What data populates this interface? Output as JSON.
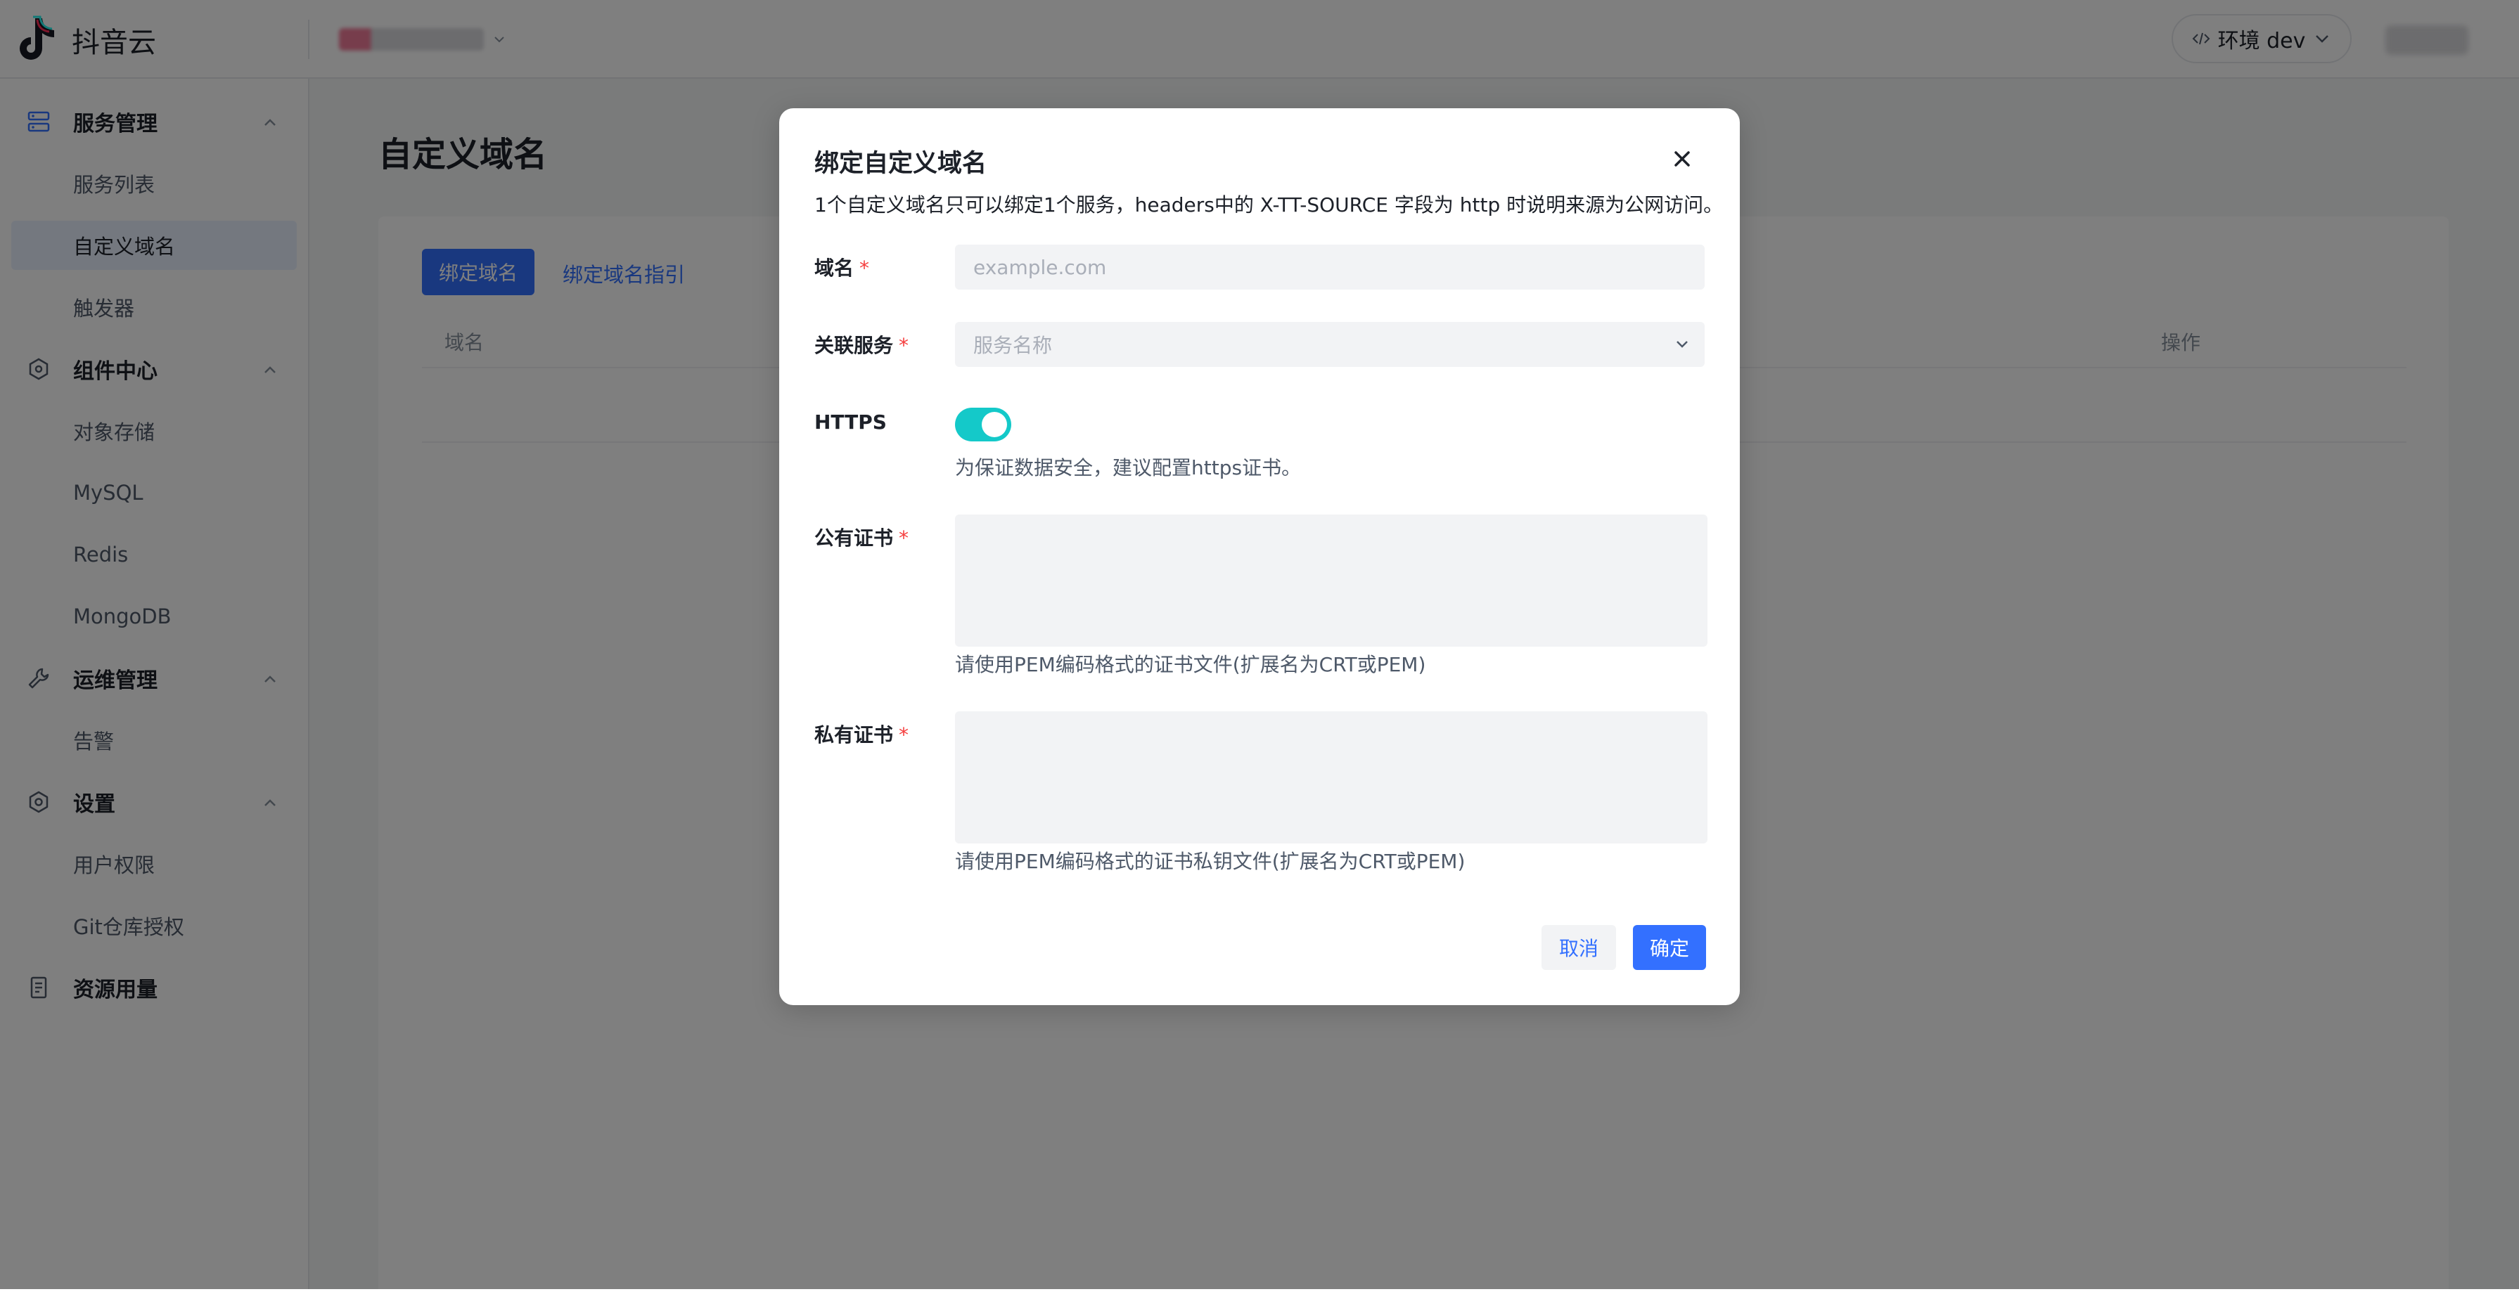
{
  "header": {
    "logo_text": "抖音云",
    "env_label": "环境 dev"
  },
  "sidebar": {
    "groups": [
      {
        "label": "服务管理",
        "items": [
          "服务列表",
          "自定义域名",
          "触发器"
        ]
      },
      {
        "label": "组件中心",
        "items": [
          "对象存储",
          "MySQL",
          "Redis",
          "MongoDB"
        ]
      },
      {
        "label": "运维管理",
        "items": [
          "告警"
        ]
      },
      {
        "label": "设置",
        "items": [
          "用户权限",
          "Git仓库授权"
        ]
      },
      {
        "label": "资源用量",
        "items": []
      }
    ],
    "active_item": "自定义域名"
  },
  "main": {
    "page_title": "自定义域名",
    "bind_button": "绑定域名",
    "guide_link": "绑定域名指引",
    "columns": [
      "域名",
      "操作"
    ]
  },
  "modal": {
    "title": "绑定自定义域名",
    "description": "1个自定义域名只可以绑定1个服务，headers中的 X-TT-SOURCE 字段为 http 时说明来源为公网访问。",
    "domain_label": "域名",
    "domain_placeholder": "example.com",
    "domain_value": "",
    "service_label": "关联服务",
    "service_placeholder": "服务名称",
    "https_label": "HTTPS",
    "https_enabled": true,
    "https_help": "为保证数据安全，建议配置https证书。",
    "public_cert_label": "公有证书",
    "public_cert_help": "请使用PEM编码格式的证书文件(扩展名为CRT或PEM)",
    "private_cert_label": "私有证书",
    "private_cert_help": "请使用PEM编码格式的证书私钥文件(扩展名为CRT或PEM)",
    "required_mark": "*",
    "cancel_label": "取消",
    "ok_label": "确定"
  },
  "colors": {
    "primary": "#3370ff",
    "toggle_on": "#14c9c9",
    "required": "#f53f3f",
    "active_nav_bg": "#e8f0fe"
  }
}
